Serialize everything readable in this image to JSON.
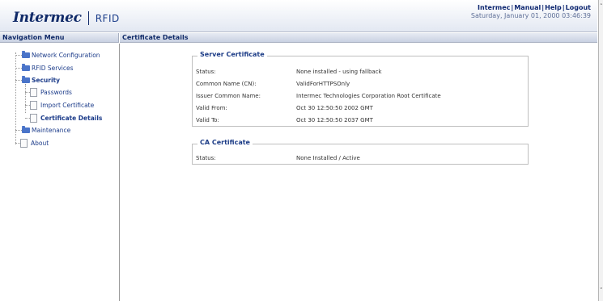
{
  "header": {
    "brand": "Intermec",
    "product": "RFID",
    "links": [
      "Intermec",
      "Manual",
      "Help",
      "Logout"
    ],
    "datetime": "Saturday, January 01, 2000 03:46:39"
  },
  "nav": {
    "title": "Navigation Menu",
    "items": [
      {
        "label": "Network Configuration",
        "icon": "folder-icon",
        "level": 0,
        "bold": false
      },
      {
        "label": "RFID Services",
        "icon": "folder-icon",
        "level": 0,
        "bold": false
      },
      {
        "label": "Security",
        "icon": "folder-icon",
        "level": 0,
        "bold": true
      },
      {
        "label": "Passwords",
        "icon": "page-icon",
        "level": 1,
        "bold": false
      },
      {
        "label": "Import Certificate",
        "icon": "page-icon",
        "level": 1,
        "bold": false
      },
      {
        "label": "Certificate Details",
        "icon": "page-icon",
        "level": 1,
        "bold": true
      },
      {
        "label": "Maintenance",
        "icon": "folder-icon",
        "level": 0,
        "bold": false
      },
      {
        "label": "About",
        "icon": "page-icon",
        "level": 0,
        "bold": false
      }
    ]
  },
  "content": {
    "title": "Certificate Details",
    "server_certificate": {
      "legend": "Server Certificate",
      "rows": [
        {
          "label": "Status:",
          "value": "None installed - using fallback"
        },
        {
          "label": "Common Name (CN):",
          "value": "ValidForHTTPSOnly"
        },
        {
          "label": "Issuer Common Name:",
          "value": "Intermec Technologies Corporation Root Certificate"
        },
        {
          "label": "Valid From:",
          "value": "Oct 30 12:50:50 2002 GMT"
        },
        {
          "label": "Valid To:",
          "value": "Oct 30 12:50:50 2037 GMT"
        }
      ]
    },
    "ca_certificate": {
      "legend": "CA Certificate",
      "rows": [
        {
          "label": "Status:",
          "value": "None Installed / Active"
        }
      ]
    }
  },
  "colors": {
    "brand_navy": "#102a68",
    "link_blue": "#1c3c8a",
    "folder_blue": "#4a74c9"
  }
}
